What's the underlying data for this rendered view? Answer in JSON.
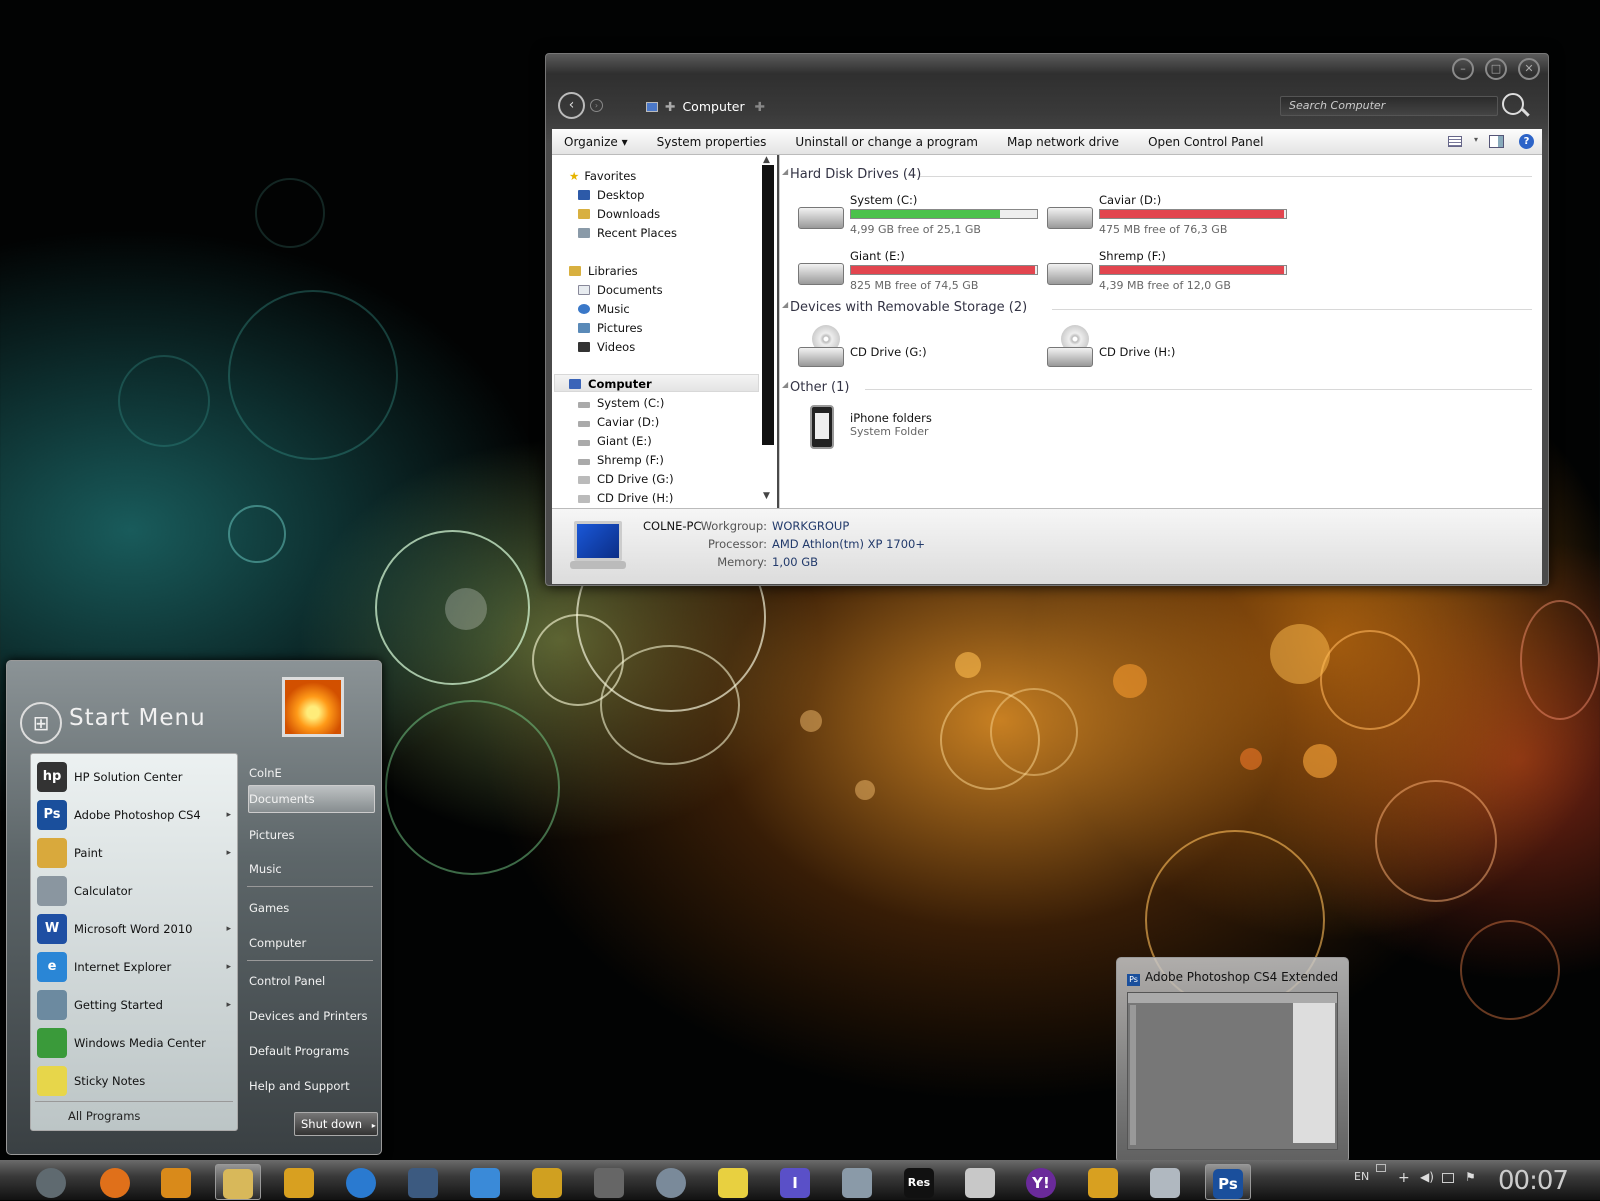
{
  "explorer": {
    "breadcrumb": "Computer",
    "search_placeholder": "Search Computer",
    "commands": [
      "Organize ▾",
      "System properties",
      "Uninstall or change a program",
      "Map network drive",
      "Open Control Panel"
    ],
    "nav": {
      "favorites": "Favorites",
      "favorites_items": [
        "Desktop",
        "Downloads",
        "Recent Places"
      ],
      "libraries": "Libraries",
      "libraries_items": [
        "Documents",
        "Music",
        "Pictures",
        "Videos"
      ],
      "computer": "Computer",
      "computer_items": [
        "System (C:)",
        "Caviar (D:)",
        "Giant (E:)",
        "Shremp (F:)",
        "CD Drive (G:)",
        "CD Drive (H:)"
      ]
    },
    "groups": {
      "hdd": "Hard Disk Drives (4)",
      "removable": "Devices with Removable Storage (2)",
      "other": "Other (1)"
    },
    "drives": [
      {
        "name": "System (C:)",
        "free": "4,99 GB free of 25,1 GB",
        "used_fraction": 0.8,
        "bar_color": "#4cc24c"
      },
      {
        "name": "Caviar (D:)",
        "free": "475 MB free of 76,3 GB",
        "used_fraction": 0.99,
        "bar_color": "#e2454f"
      },
      {
        "name": "Giant (E:)",
        "free": "825 MB free of 74,5 GB",
        "used_fraction": 0.99,
        "bar_color": "#e2454f"
      },
      {
        "name": "Shremp (F:)",
        "free": "4,39 MB free of 12,0 GB",
        "used_fraction": 0.99,
        "bar_color": "#e2454f"
      }
    ],
    "cd_drives": [
      "CD Drive (G:)",
      "CD Drive (H:)"
    ],
    "other_item": {
      "name": "iPhone folders",
      "type": "System Folder"
    },
    "details": {
      "pc_name": "COLNE-PC",
      "workgroup_label": "Workgroup:",
      "workgroup": "WORKGROUP",
      "processor_label": "Processor:",
      "processor": "AMD Athlon(tm) XP 1700+",
      "memory_label": "Memory:",
      "memory": "1,00 GB"
    }
  },
  "start_menu": {
    "title": "Start Menu",
    "programs": [
      {
        "label": "HP Solution Center",
        "icon": "hp-icon",
        "color": "#333333",
        "glyph": "hp",
        "has_arrow": false
      },
      {
        "label": "Adobe Photoshop CS4",
        "icon": "photoshop-icon",
        "color": "#1a4f9c",
        "glyph": "Ps",
        "has_arrow": true
      },
      {
        "label": "Paint",
        "icon": "paint-icon",
        "color": "#d9a93c",
        "glyph": "",
        "has_arrow": true
      },
      {
        "label": "Calculator",
        "icon": "calculator-icon",
        "color": "#8a96a0",
        "glyph": "",
        "has_arrow": false
      },
      {
        "label": "Microsoft Word 2010",
        "icon": "word-icon",
        "color": "#1f4fa3",
        "glyph": "W",
        "has_arrow": true
      },
      {
        "label": "Internet Explorer",
        "icon": "ie-icon",
        "color": "#2a86d6",
        "glyph": "e",
        "has_arrow": true
      },
      {
        "label": "Getting Started",
        "icon": "getting-started-icon",
        "color": "#6c8aa0",
        "glyph": "",
        "has_arrow": true
      },
      {
        "label": "Windows Media Center",
        "icon": "media-center-icon",
        "color": "#3a9a3a",
        "glyph": "",
        "has_arrow": false
      },
      {
        "label": "Sticky Notes",
        "icon": "sticky-notes-icon",
        "color": "#e7d64a",
        "glyph": "",
        "has_arrow": false
      }
    ],
    "all_programs": "All Programs",
    "right_items": [
      "ColnE",
      "Documents",
      "Pictures",
      "Music",
      "Games",
      "Computer",
      "Control Panel",
      "Devices and Printers",
      "Default Programs",
      "Help and Support"
    ],
    "shutdown": "Shut down"
  },
  "thumbnail": {
    "title": "Adobe Photoshop CS4 Extended",
    "icon_text": "Ps"
  },
  "taskbar": {
    "items": [
      {
        "name": "start-orb-icon",
        "color": "#5f6a70",
        "glyph": ""
      },
      {
        "name": "firefox-icon",
        "color": "#e0701a",
        "glyph": ""
      },
      {
        "name": "media-player-icon",
        "color": "#d98a1a",
        "glyph": ""
      },
      {
        "name": "explorer-icon",
        "color": "#d8b85a",
        "glyph": ""
      },
      {
        "name": "winamp-icon",
        "color": "#d8a020",
        "glyph": ""
      },
      {
        "name": "itunes-icon",
        "color": "#2a7ad0",
        "glyph": ""
      },
      {
        "name": "kmplayer-icon",
        "color": "#3c5a80",
        "glyph": ""
      },
      {
        "name": "sync-icon",
        "color": "#3a8ad8",
        "glyph": ""
      },
      {
        "name": "headphones-icon",
        "color": "#d0a020",
        "glyph": ""
      },
      {
        "name": "phone-icon",
        "color": "#666666",
        "glyph": ""
      },
      {
        "name": "camera-icon",
        "color": "#7a8a9a",
        "glyph": ""
      },
      {
        "name": "notepad-icon",
        "color": "#e8d040",
        "glyph": ""
      },
      {
        "name": "text-icon",
        "color": "#5a50c8",
        "glyph": "I"
      },
      {
        "name": "monitor-icon",
        "color": "#8a9aa8",
        "glyph": ""
      },
      {
        "name": "reshacker-icon",
        "color": "#111111",
        "glyph": "Res"
      },
      {
        "name": "wordpad-icon",
        "color": "#c8c8c8",
        "glyph": ""
      },
      {
        "name": "yahoo-messenger-icon",
        "color": "#6a2a9a",
        "glyph": "Y!"
      },
      {
        "name": "tools-icon",
        "color": "#d8a020",
        "glyph": ""
      },
      {
        "name": "paint-icon",
        "color": "#b0b8c0",
        "glyph": ""
      },
      {
        "name": "photoshop-icon",
        "color": "#1a4f9c",
        "glyph": "Ps"
      }
    ],
    "language": "EN",
    "clock": "00:07"
  }
}
